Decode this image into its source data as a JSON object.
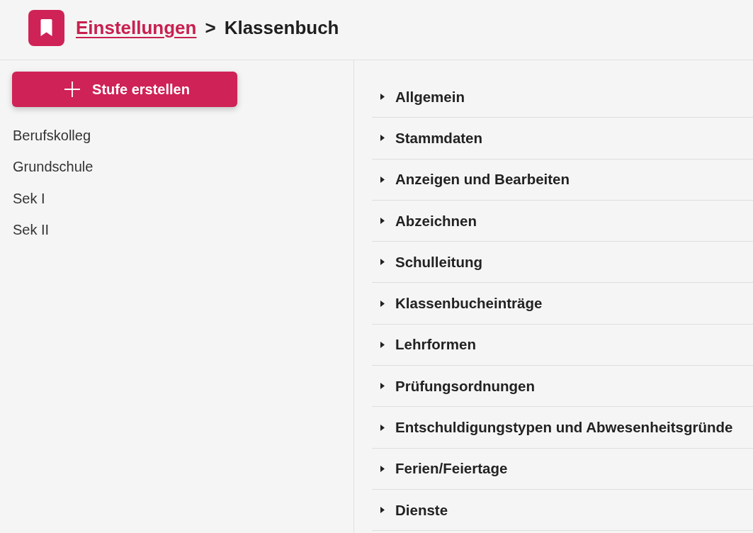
{
  "header": {
    "breadcrumb": {
      "link": "Einstellungen",
      "separator": ">",
      "current": "Klassenbuch"
    }
  },
  "sidebar": {
    "create_button": {
      "label": "Stufe erstellen"
    },
    "items": [
      {
        "label": "Berufskolleg",
        "selected": false
      },
      {
        "label": "Grundschule",
        "selected": false
      },
      {
        "label": "Sek I",
        "selected": false
      },
      {
        "label": "Sek II",
        "selected": false
      }
    ]
  },
  "sections": [
    {
      "label": "Allgemein",
      "expanded": false
    },
    {
      "label": "Stammdaten",
      "expanded": false
    },
    {
      "label": "Anzeigen und Bearbeiten",
      "expanded": false
    },
    {
      "label": "Abzeichnen",
      "expanded": false
    },
    {
      "label": "Schulleitung",
      "expanded": false
    },
    {
      "label": "Klassenbucheinträge",
      "expanded": false
    },
    {
      "label": "Lehrformen",
      "expanded": false
    },
    {
      "label": "Prüfungsordnungen",
      "expanded": false
    },
    {
      "label": "Entschuldigungstypen und Abwesenheitsgründe",
      "expanded": false
    },
    {
      "label": "Ferien/Feiertage",
      "expanded": false
    },
    {
      "label": "Dienste",
      "expanded": false
    }
  ]
}
